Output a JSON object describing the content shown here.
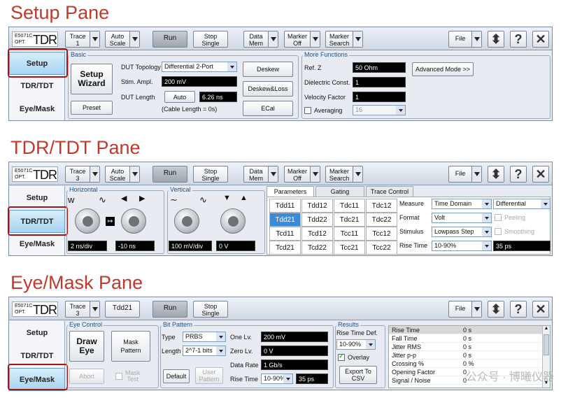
{
  "headings": {
    "setup": "Setup Pane",
    "tdr": "TDR/TDT Pane",
    "eye": "Eye/Mask Pane"
  },
  "logo": {
    "line1": "E5071C",
    "line2": "OPT.",
    "big": "TDR"
  },
  "toolbar": {
    "trace_label": "Trace",
    "trace1": "1",
    "trace3": "3",
    "auto_scale_1": "Auto",
    "auto_scale_2": "Scale",
    "run": "Run",
    "stop1": "Stop",
    "stop2": "Single",
    "data1": "Data",
    "data2": "Mem",
    "marker1": "Marker",
    "marker2": "Off",
    "msearch1": "Marker",
    "msearch2": "Search",
    "file": "File",
    "help": "?",
    "close": "✕",
    "tdd21": "Tdd21"
  },
  "sidebar": {
    "setup": "Setup",
    "tdr": "TDR/TDT",
    "eye": "Eye/Mask"
  },
  "setup": {
    "basic": "Basic",
    "setup_wizard_1": "Setup",
    "setup_wizard_2": "Wizard",
    "preset": "Preset",
    "dut_topology_label": "DUT Topology",
    "dut_topology": "Differential 2-Port",
    "stim_label": "Stim. Ampl.",
    "stim": "200 mV",
    "dut_len_label": "DUT Length",
    "auto": "Auto",
    "dut_len": "6.26 ns",
    "cable_len": "(Cable Length =  0s)",
    "deskew": "Deskew",
    "deskew_loss": "Deskew&Loss",
    "ecal": "ECal",
    "more": "More Functions",
    "refz_label": "Ref. Z",
    "refz": "50 Ohm",
    "diel_label": "Dielectric Const.",
    "diel": "1",
    "vel_label": "Velocity Factor",
    "vel": "1",
    "avg_label": "Averaging",
    "avg": "16",
    "advanced": "Advanced Mode >>"
  },
  "tdr": {
    "horizontal": "Horizontal",
    "vertical": "Vertical",
    "h_scale": "2 ns/div",
    "h_offset": "-10 ns",
    "v_scale": "100 mV/div",
    "v_offset": "0 V",
    "tabs": [
      "Parameters",
      "Gating",
      "Trace Control"
    ],
    "params": [
      [
        "Tdd11",
        "Tdd12",
        "Tdc11",
        "Tdc12"
      ],
      [
        "Tdd21",
        "Tdd22",
        "Tdc21",
        "Tdc22"
      ],
      [
        "Tcd11",
        "Tcd12",
        "Tcc11",
        "Tcc12"
      ],
      [
        "Tcd21",
        "Tcd22",
        "Tcc21",
        "Tcc22"
      ]
    ],
    "measure_label": "Measure",
    "measure": "Time Domain",
    "measure2": "Differential",
    "format_label": "Format",
    "format": "Volt",
    "peeling": "Peeling",
    "stimulus_label": "Stimulus",
    "stimulus": "Lowpass Step",
    "smoothing": "Smoothing",
    "rise_label": "Rise Time",
    "rise": "10-90%",
    "rise_val": "35 ps"
  },
  "eye": {
    "eye_control": "Eye Control",
    "draw_eye_1": "Draw",
    "draw_eye_2": "Eye",
    "mask_pattern_1": "Mask",
    "mask_pattern_2": "Pattern",
    "abort": "Abort",
    "mask_test_1": "Mask",
    "mask_test_2": "Test",
    "bit_pattern": "Bit Pattern",
    "type_label": "Type",
    "type": "PRBS",
    "length_label": "Length",
    "length": "2^7-1 bits",
    "one_label": "One Lv.",
    "one": "200 mV",
    "zero_label": "Zero Lv.",
    "zero": "0 V",
    "rate_label": "Data Rate",
    "rate": "1 Gb/s",
    "rise_label": "Rise Time",
    "rise": "10-90%",
    "rise_val": "35 ps",
    "default": "Default",
    "user_pattern_1": "User",
    "user_pattern_2": "Pattern",
    "results": "Results",
    "rise_def_label": "Rise Time Def.",
    "rise_def": "10-90%",
    "overlay": "Overlay",
    "export_1": "Export To",
    "export_2": "CSV",
    "table": [
      [
        "Rise Time",
        "0 s"
      ],
      [
        "Fall Time",
        "0 s"
      ],
      [
        "Jitter RMS",
        "0 s"
      ],
      [
        "Jitter p-p",
        "0 s"
      ],
      [
        "Crossing %",
        "0 %"
      ],
      [
        "Opening Factor",
        "0"
      ],
      [
        "Signal / Noise",
        "0"
      ]
    ]
  },
  "watermark": "公众号 · 博曦仪器"
}
